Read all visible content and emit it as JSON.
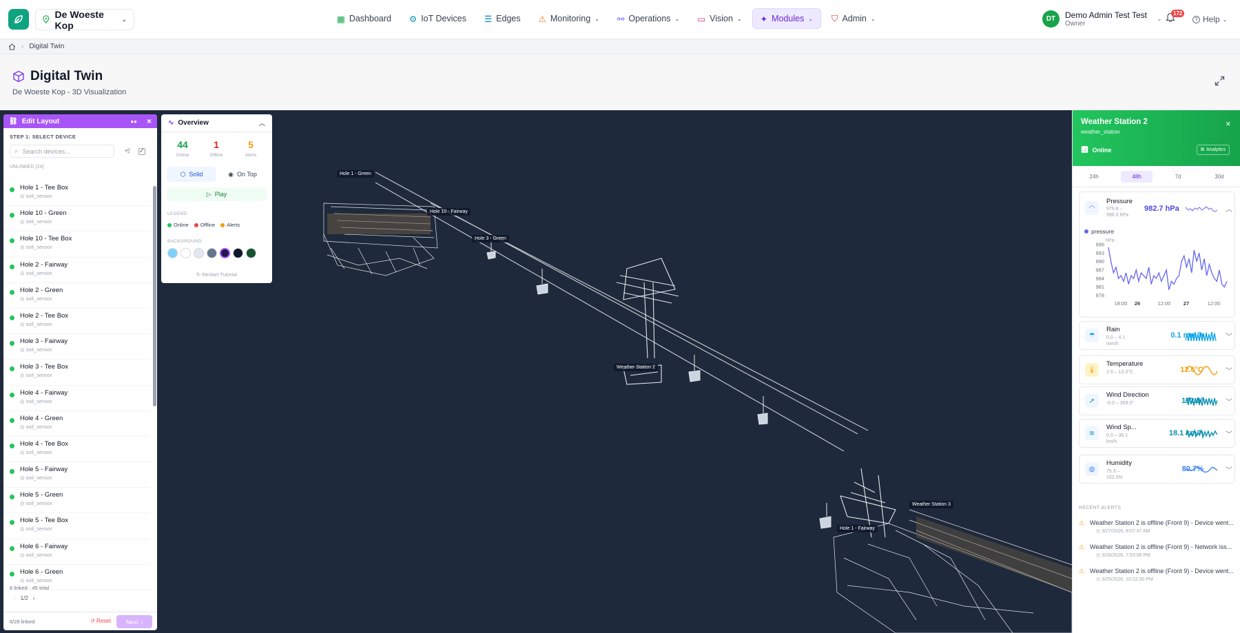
{
  "topbar": {
    "site": "De Woeste Kop",
    "nav": [
      "Dashboard",
      "IoT Devices",
      "Edges",
      "Monitoring",
      "Operations",
      "Vision",
      "Modules",
      "Admin"
    ],
    "user_initials": "DT",
    "user_name": "Demo Admin Test Test",
    "user_role": "Owner",
    "notif_count": "172",
    "help": "Help"
  },
  "breadcrumb": {
    "current": "Digital Twin"
  },
  "page": {
    "title": "Digital Twin",
    "subtitle": "De Woeste Kop - 3D Visualization"
  },
  "scene_labels": [
    "Hole 1 - Green",
    "Hole 10 - Fairway",
    "Hole 3 - Green",
    "Weather Station 2",
    "Weather Station 3",
    "Hole 1 - Fairway"
  ],
  "edit_layout": {
    "title": "Edit Layout",
    "step": "STEP 1: SELECT DEVICE",
    "search_placeholder": "Search devices...",
    "unlinked": "UNLINKED (24)",
    "devices": [
      {
        "name": "Hole 1 - Tee Box",
        "type": "soil_sensor"
      },
      {
        "name": "Hole 10 - Green",
        "type": "soil_sensor"
      },
      {
        "name": "Hole 10 - Tee Box",
        "type": "soil_sensor"
      },
      {
        "name": "Hole 2 - Fairway",
        "type": "soil_sensor"
      },
      {
        "name": "Hole 2 - Green",
        "type": "soil_sensor"
      },
      {
        "name": "Hole 2 - Tee Box",
        "type": "soil_sensor"
      },
      {
        "name": "Hole 3 - Fairway",
        "type": "soil_sensor"
      },
      {
        "name": "Hole 3 - Tee Box",
        "type": "soil_sensor"
      },
      {
        "name": "Hole 4 - Fairway",
        "type": "soil_sensor"
      },
      {
        "name": "Hole 4 - Green",
        "type": "soil_sensor"
      },
      {
        "name": "Hole 4 - Tee Box",
        "type": "soil_sensor"
      },
      {
        "name": "Hole 5 - Fairway",
        "type": "soil_sensor"
      },
      {
        "name": "Hole 5 - Green",
        "type": "soil_sensor"
      },
      {
        "name": "Hole 5 - Tee Box",
        "type": "soil_sensor"
      },
      {
        "name": "Hole 6 - Fairway",
        "type": "soil_sensor"
      },
      {
        "name": "Hole 6 - Green",
        "type": "soil_sensor"
      }
    ],
    "summary": "6 linked · 45 total",
    "page": "1/2",
    "linked": "6/28 linked",
    "reset": "Reset",
    "next": "Next"
  },
  "overview": {
    "title": "Overview",
    "online": "44",
    "online_label": "Online",
    "offline": "1",
    "offline_label": "Offline",
    "alerts": "5",
    "alerts_label": "Alerts",
    "solid": "Solid",
    "on_top": "On Top",
    "play": "Play",
    "legend_title": "LEGEND",
    "legend_online": "Online",
    "legend_offline": "Offline",
    "legend_alerts": "Alerts",
    "background_title": "BACKGROUND:",
    "restart": "Restart Tutorial",
    "bg_colors": [
      "#7dd3fc",
      "#ffffff",
      "#e2e8f0",
      "#64748b",
      "#1e1b4b",
      "#0f172a",
      "#14532d"
    ]
  },
  "weather": {
    "title": "Weather Station 2",
    "subtitle": "weather_station",
    "status": "Online",
    "analytics": "Analytics",
    "ranges": [
      "24h",
      "48h",
      "7d",
      "30d"
    ],
    "pressure": {
      "name": "Pressure",
      "range": "979.8 – 996.0 hPa",
      "value": "982.7 hPa",
      "legend": "pressure",
      "unit": "hPa",
      "yticks": [
        "996",
        "993",
        "990",
        "987",
        "984",
        "981",
        "978"
      ],
      "xticks": [
        "18:00",
        "26",
        "12:00",
        "27",
        "12:00"
      ]
    },
    "metrics": [
      {
        "name": "Rain",
        "range": "0.0 – 4.1 mm/h",
        "value": "0.1 mm/h",
        "color": "#0ea5e9"
      },
      {
        "name": "Temperature",
        "range": "2.6 – 13.3°C",
        "value": "12.6°C",
        "color": "#f59e0b"
      },
      {
        "name": "Wind Direction",
        "range": "-6.0 – 369.0°",
        "value": "172.0°",
        "color": "#0891b2"
      },
      {
        "name": "Wind Sp...",
        "range": "0.0 – 36.1 km/h",
        "value": "18.1 km/h",
        "color": "#0891b2"
      },
      {
        "name": "Humidity",
        "range": "75.3 – 102.0%",
        "value": "80.7%",
        "color": "#3b82f6"
      }
    ],
    "recent_alerts": "RECENT ALERTS",
    "alerts": [
      {
        "text": "Weather Station 2 is offline (Front 9) - Device went...",
        "time": "3/27/2026, 8:07:47 AM"
      },
      {
        "text": "Weather Station 2 is offline (Front 9) - Network iss...",
        "time": "3/26/2026, 7:53:06 PM"
      },
      {
        "text": "Weather Station 2 is offline (Front 9) - Device went...",
        "time": "3/25/2026, 10:22:30 PM"
      }
    ]
  },
  "chart_data": {
    "type": "line",
    "series": [
      {
        "name": "pressure",
        "values": [
          995,
          990,
          986,
          988,
          984,
          985,
          983,
          986,
          982,
          985,
          984,
          987,
          983,
          986,
          985,
          984,
          988,
          982,
          985,
          984,
          986,
          983,
          985,
          987,
          980,
          983,
          982,
          984,
          985,
          990,
          992,
          988,
          991,
          986,
          994,
          990,
          993,
          987,
          991,
          985,
          989,
          986,
          984,
          983,
          987,
          982,
          981,
          983
        ]
      }
    ],
    "ylim": [
      978,
      996
    ],
    "xticks": [
      "18:00",
      "26",
      "12:00",
      "27",
      "12:00"
    ]
  }
}
